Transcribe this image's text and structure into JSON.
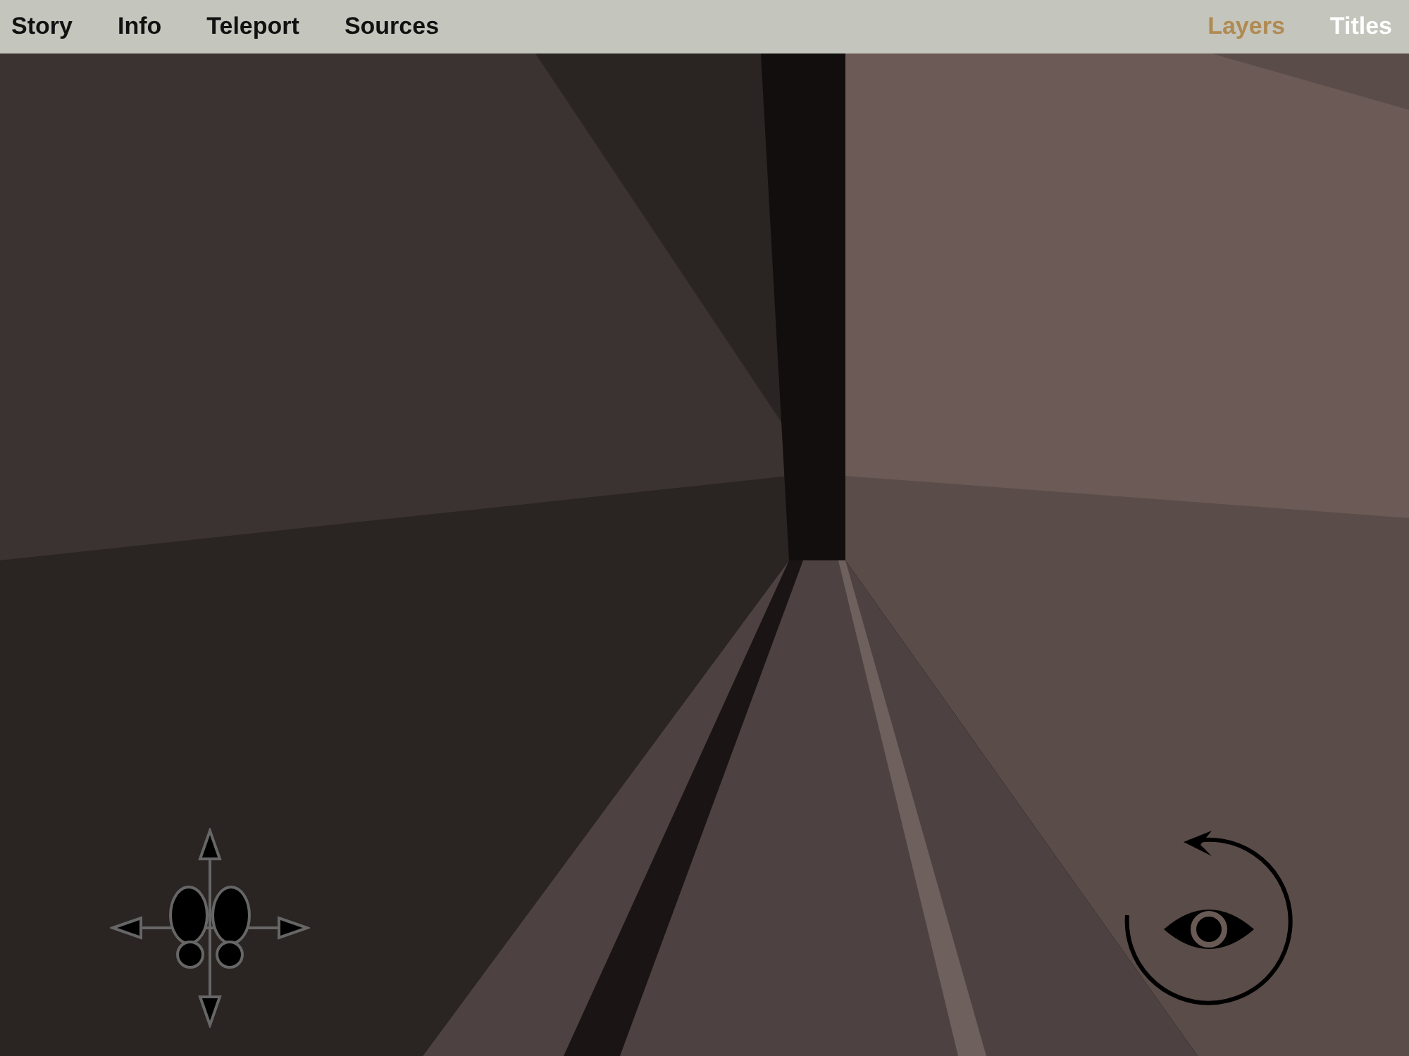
{
  "menu": {
    "left": [
      "Story",
      "Info",
      "Teleport",
      "Sources"
    ],
    "right": [
      {
        "label": "Layers",
        "selected": true
      },
      {
        "label": "Titles",
        "selected": false
      }
    ]
  }
}
